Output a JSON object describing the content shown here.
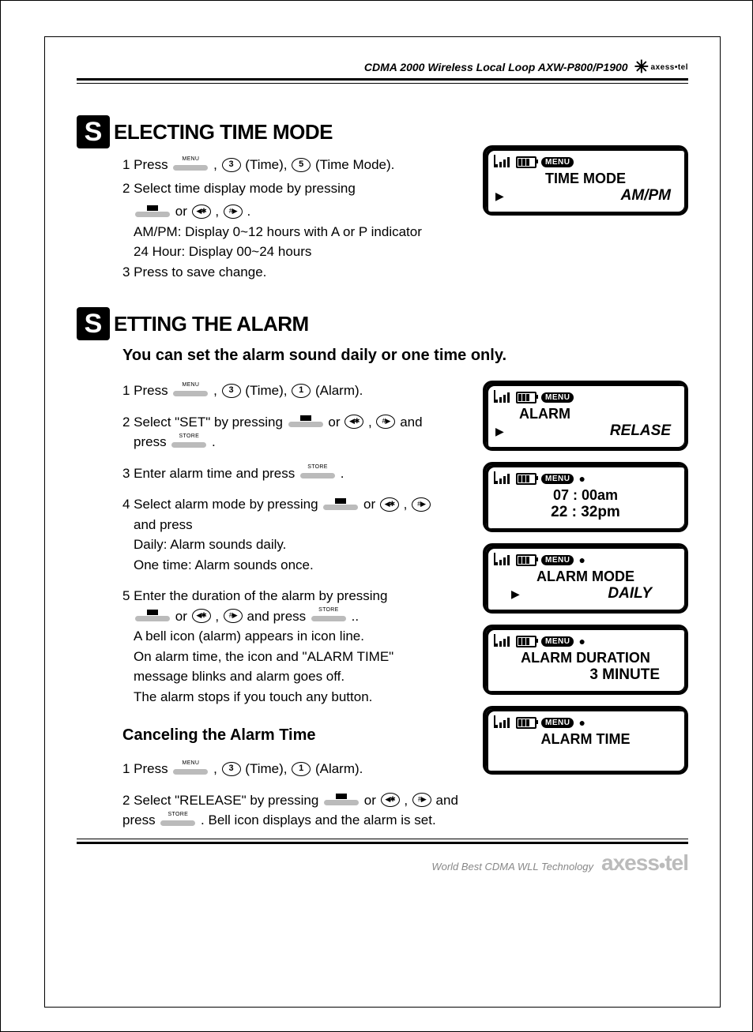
{
  "header": {
    "product": "CDMA 2000 Wireless Local Loop AXW-P800/P1900",
    "brand_small": "axess•tel"
  },
  "section1": {
    "dropcap": "S",
    "title": "ELECTING TIME MODE",
    "steps": {
      "s1a": "1 Press ",
      "s1b": " , ",
      "s1c": "(Time), ",
      "s1d": " (Time Mode).",
      "d3": "3",
      "d5": "5",
      "s2": "2 Select time display mode by pressing",
      "s2b_or": " or ",
      "s2b_end": " , ",
      "s2b_period": " .",
      "ampm": "AM/PM: Display 0~12 hours with A or P indicator",
      "h24": "24 Hour: Display 00~24 hours",
      "s3": "3 Press   to save change."
    },
    "screen": {
      "menu": "MENU",
      "l1": "TIME MODE",
      "l2": "AM/PM"
    }
  },
  "section2": {
    "dropcap": "S",
    "title": "ETTING THE ALARM",
    "intro": "You can set the alarm sound daily or one time only.",
    "steps": {
      "s1a": "1 Press ",
      "s1b": " , ",
      "s1c": " (Time), ",
      "s1d": " (Alarm).",
      "d3": "3",
      "d1": "1",
      "s2a": "2 Select \"SET\" by pressing ",
      "s2b": "or",
      "s2c": ", ",
      "s2d": " and",
      "s2e": "press ",
      "s2f": " .",
      "s3a": "3 Enter alarm time and press ",
      "s3b": " .",
      "s4a": "4 Select alarm mode by pressing ",
      "s4b": " or",
      "s4c": ",",
      "s4d": "and press",
      "s4e": "Daily: Alarm sounds daily.",
      "s4f": "One time: Alarm sounds once.",
      "s5a": "5 Enter the duration of the alarm by pressing",
      "s5b_or": "or ",
      "s5b_comma": " , ",
      "s5b_and": " and press ",
      "s5b_end": " ..",
      "s5c": "A bell icon (alarm) appears in icon line.",
      "s5d": "On alarm time, the icon and \"ALARM TIME\"",
      "s5e": "message blinks and alarm goes off.",
      "s5f": "The alarm stops if you touch any button."
    },
    "cancel_title": "Canceling the Alarm Time",
    "cancel": {
      "c1a": "1 Press ",
      "c1b": " , ",
      "c1c": "(Time),",
      "c1d": "(Alarm).",
      "d3": "3",
      "d1": "1",
      "c2a": "2 Select \"RELEASE\" by pressing ",
      "c2b": " or ",
      "c2c": " , ",
      "c2d": "and",
      "c3a": "press ",
      "c3b": " . Bell icon displays and the alarm is set."
    },
    "screens": {
      "menu": "MENU",
      "s1l1": "ALARM",
      "s1l2": "RELASE",
      "s2l1": "07 : 00am",
      "s2l2": "22 : 32pm",
      "s3l1": "ALARM MODE",
      "s3l2": "DAILY",
      "s4l1": "ALARM DURATION",
      "s4l2": "3 MINUTE",
      "s5l1": "ALARM TIME"
    }
  },
  "footer": {
    "tagline": "World Best CDMA WLL Technology",
    "brand_a": "axess",
    "brand_b": "tel"
  }
}
